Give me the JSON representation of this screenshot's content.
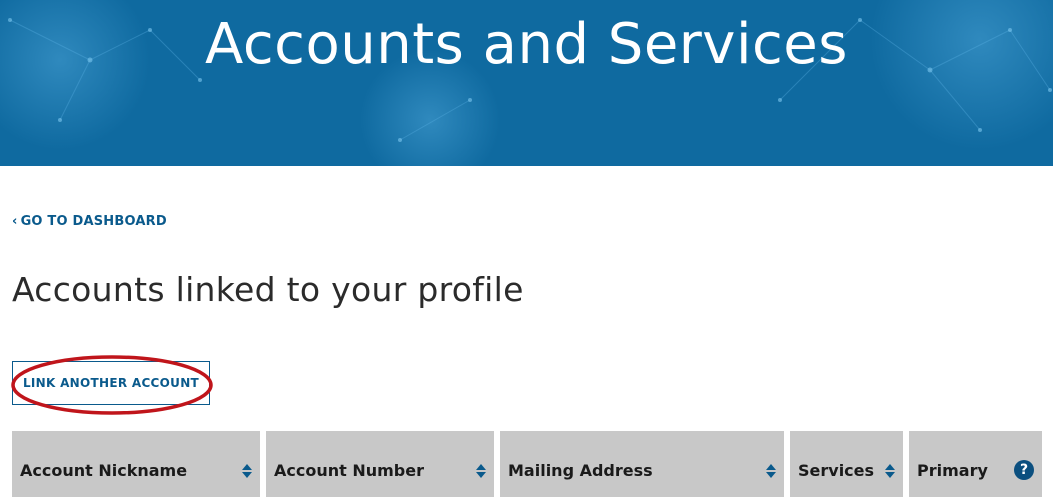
{
  "header": {
    "title": "Accounts and Services"
  },
  "nav": {
    "back_link": "GO TO DASHBOARD",
    "back_icon": "chevron-left-icon"
  },
  "main": {
    "heading": "Accounts linked to your profile",
    "link_account_button": "LINK ANOTHER ACCOUNT"
  },
  "table": {
    "columns": [
      {
        "label": "Account Nickname",
        "icon": "sort-icon"
      },
      {
        "label": "Account Number",
        "icon": "sort-icon"
      },
      {
        "label": "Mailing Address",
        "icon": "sort-icon"
      },
      {
        "label": "Services",
        "icon": "sort-icon"
      },
      {
        "label": "Primary",
        "icon": "help-icon"
      }
    ],
    "help_glyph": "?"
  },
  "colors": {
    "hero_background": "#0f6aa0",
    "link_blue": "#0a5a8c",
    "header_cell_gray": "#c8c8c8",
    "annotation_red": "#c0151b"
  }
}
